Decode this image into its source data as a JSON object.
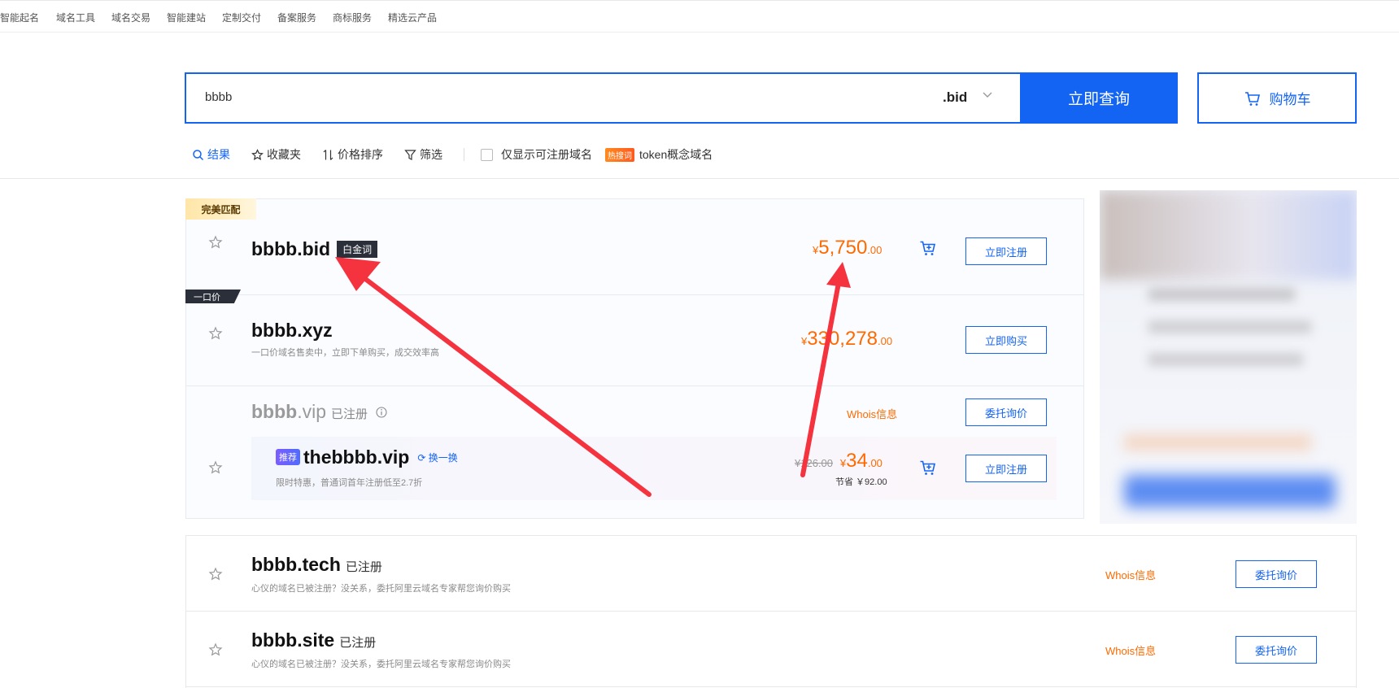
{
  "topnav": [
    "智能起名",
    "域名工具",
    "域名交易",
    "智能建站",
    "定制交付",
    "备案服务",
    "商标服务",
    "精选云产品"
  ],
  "search": {
    "query": "bbbb",
    "suffix": ".bid",
    "button": "立即查询",
    "cart": "购物车"
  },
  "filters": {
    "results": "结果",
    "favorites": "收藏夹",
    "price_sort": "价格排序",
    "filter": "筛选",
    "only_available": "仅显示可注册域名",
    "hot_tag": "热搜词",
    "hot_text": "token概念域名"
  },
  "results": [
    {
      "badge": "完美匹配",
      "name": "bbbb.bid",
      "tag": "白金词",
      "currency": "¥",
      "price_int": "5,750",
      "price_dec": ".00",
      "action": "立即注册"
    },
    {
      "badge": "一口价",
      "name": "bbbb.xyz",
      "desc": "一口价域名售卖中，立即下单购买，成交效率高",
      "currency": "¥",
      "price_int": "330,278",
      "price_dec": ".00",
      "action": "立即购买"
    },
    {
      "name_base": "bbbb",
      "name_tld": ".vip",
      "status": "已注册",
      "whois": "Whois信息",
      "action": "委托询价",
      "recommend": {
        "tag": "推荐",
        "name": "thebbbb.vip",
        "swap": "换一换",
        "desc": "限时特惠，普通词首年注册低至2.7折",
        "old_price": "¥126.00",
        "currency": "¥",
        "price_int": "34",
        "price_dec": ".00",
        "save": "节省 ￥92.00",
        "action": "立即注册"
      }
    }
  ],
  "list": [
    {
      "name": "bbbb.tech",
      "status": "已注册",
      "desc": "心仪的域名已被注册？没关系，委托阿里云域名专家帮您询价购买",
      "whois": "Whois信息",
      "action": "委托询价"
    },
    {
      "name": "bbbb.site",
      "status": "已注册",
      "desc": "心仪的域名已被注册？没关系，委托阿里云域名专家帮您询价购买",
      "whois": "Whois信息",
      "action": "委托询价"
    }
  ],
  "colors": {
    "primary": "#1464f4",
    "price": "#ff6a00",
    "annotation_arrow": "#f5333f"
  }
}
